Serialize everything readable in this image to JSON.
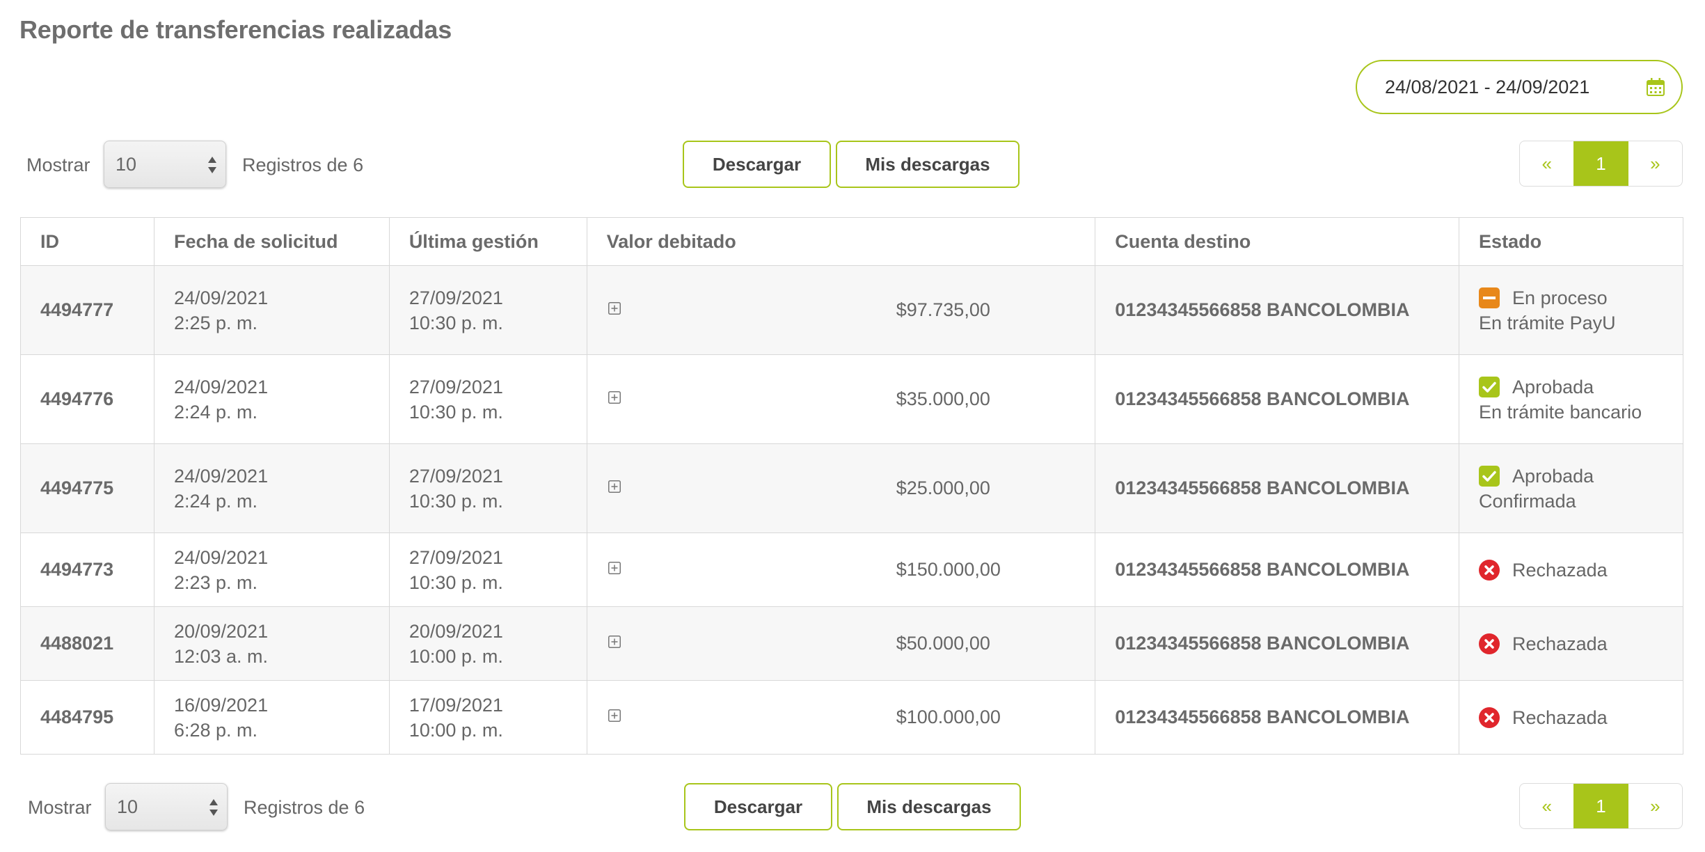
{
  "page": {
    "title": "Reporte de transferencias realizadas",
    "date_range": "24/08/2021 - 24/09/2021"
  },
  "controls": {
    "show_label": "Mostrar",
    "page_size": "10",
    "records_label": "Registros de 6",
    "download_label": "Descargar",
    "my_downloads_label": "Mis descargas",
    "pager": {
      "prev": "«",
      "current": "1",
      "next": "»"
    }
  },
  "table": {
    "headers": [
      "ID",
      "Fecha de solicitud",
      "Última gestión",
      "Valor debitado",
      "Cuenta destino",
      "Estado"
    ],
    "rows": [
      {
        "id": "4494777",
        "req_date": "24/09/2021",
        "req_time": "2:25 p. m.",
        "last_date": "27/09/2021",
        "last_time": "10:30 p. m.",
        "value": "$97.735,00",
        "account": "01234345566858 BANCOLOMBIA",
        "status": "En proceso",
        "status_type": "processing",
        "sub_status": "En trámite PayU"
      },
      {
        "id": "4494776",
        "req_date": "24/09/2021",
        "req_time": "2:24 p. m.",
        "last_date": "27/09/2021",
        "last_time": "10:30 p. m.",
        "value": "$35.000,00",
        "account": "01234345566858 BANCOLOMBIA",
        "status": "Aprobada",
        "status_type": "approved",
        "sub_status": "En trámite bancario"
      },
      {
        "id": "4494775",
        "req_date": "24/09/2021",
        "req_time": "2:24 p. m.",
        "last_date": "27/09/2021",
        "last_time": "10:30 p. m.",
        "value": "$25.000,00",
        "account": "01234345566858 BANCOLOMBIA",
        "status": "Aprobada",
        "status_type": "approved",
        "sub_status": "Confirmada"
      },
      {
        "id": "4494773",
        "req_date": "24/09/2021",
        "req_time": "2:23 p. m.",
        "last_date": "27/09/2021",
        "last_time": "10:30 p. m.",
        "value": "$150.000,00",
        "account": "01234345566858 BANCOLOMBIA",
        "status": "Rechazada",
        "status_type": "rejected",
        "sub_status": ""
      },
      {
        "id": "4488021",
        "req_date": "20/09/2021",
        "req_time": "12:03 a. m.",
        "last_date": "20/09/2021",
        "last_time": "10:00 p. m.",
        "value": "$50.000,00",
        "account": "01234345566858 BANCOLOMBIA",
        "status": "Rechazada",
        "status_type": "rejected",
        "sub_status": ""
      },
      {
        "id": "4484795",
        "req_date": "16/09/2021",
        "req_time": "6:28 p. m.",
        "last_date": "17/09/2021",
        "last_time": "10:00 p. m.",
        "value": "$100.000,00",
        "account": "01234345566858 BANCOLOMBIA",
        "status": "Rechazada",
        "status_type": "rejected",
        "sub_status": ""
      }
    ]
  },
  "icons": {
    "calendar": "calendar-icon",
    "expand": "plus-square-icon",
    "processing": "minus-square-icon",
    "approved": "check-square-icon",
    "rejected": "x-circle-icon"
  },
  "colors": {
    "accent": "#a8c51a",
    "processing": "#e8881a",
    "approved": "#a8c51a",
    "rejected": "#e0262c"
  }
}
